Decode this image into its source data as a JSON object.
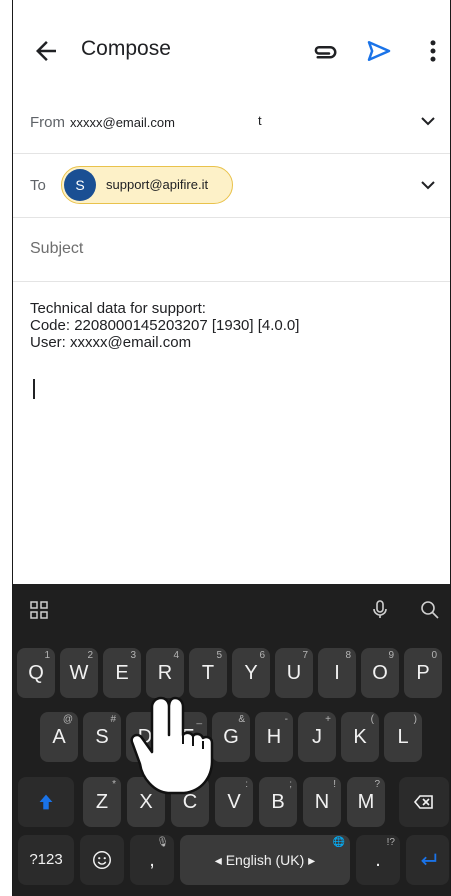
{
  "appbar": {
    "title": "Compose"
  },
  "from": {
    "label": "From",
    "value": "xxxxx@email.com",
    "extra": "t"
  },
  "to": {
    "label": "To",
    "chip_initial": "S",
    "chip_email": "support@apifire.it"
  },
  "subject": {
    "placeholder": "Subject"
  },
  "body": {
    "line1": "Technical data for support:",
    "line2": "Code: 2208000145203207 [1930] [4.0.0]",
    "line3": "User: xxxxx@email.com"
  },
  "keyboard": {
    "row1": [
      {
        "label": "Q",
        "hint": "1"
      },
      {
        "label": "W",
        "hint": "2"
      },
      {
        "label": "E",
        "hint": "3"
      },
      {
        "label": "R",
        "hint": "4"
      },
      {
        "label": "T",
        "hint": "5"
      },
      {
        "label": "Y",
        "hint": "6"
      },
      {
        "label": "U",
        "hint": "7"
      },
      {
        "label": "I",
        "hint": "8"
      },
      {
        "label": "O",
        "hint": "9"
      },
      {
        "label": "P",
        "hint": "0"
      }
    ],
    "row2": [
      {
        "label": "A",
        "hint": "@"
      },
      {
        "label": "S",
        "hint": "#"
      },
      {
        "label": "D",
        "hint": ""
      },
      {
        "label": "F",
        "hint": "_"
      },
      {
        "label": "G",
        "hint": "&"
      },
      {
        "label": "H",
        "hint": "-"
      },
      {
        "label": "J",
        "hint": "+"
      },
      {
        "label": "K",
        "hint": "("
      },
      {
        "label": "L",
        "hint": ")"
      }
    ],
    "row3": [
      {
        "label": "Z",
        "hint": "*"
      },
      {
        "label": "X",
        "hint": "\""
      },
      {
        "label": "C",
        "hint": "'"
      },
      {
        "label": "V",
        "hint": ":"
      },
      {
        "label": "B",
        "hint": ";"
      },
      {
        "label": "N",
        "hint": "!"
      },
      {
        "label": "M",
        "hint": "?"
      }
    ],
    "symbols_label": "?123",
    "comma": ",",
    "space_label": "◂ English (UK) ▸",
    "period": ".",
    "period_hint": "!?"
  },
  "colors": {
    "accent_blue": "#1a73e8",
    "chip_bg": "#fdf1c8",
    "chip_border": "#e9c24b",
    "avatar": "#1a4f93",
    "keyboard_bg": "#1f1f1f",
    "key_bg": "#3a3a3a"
  }
}
